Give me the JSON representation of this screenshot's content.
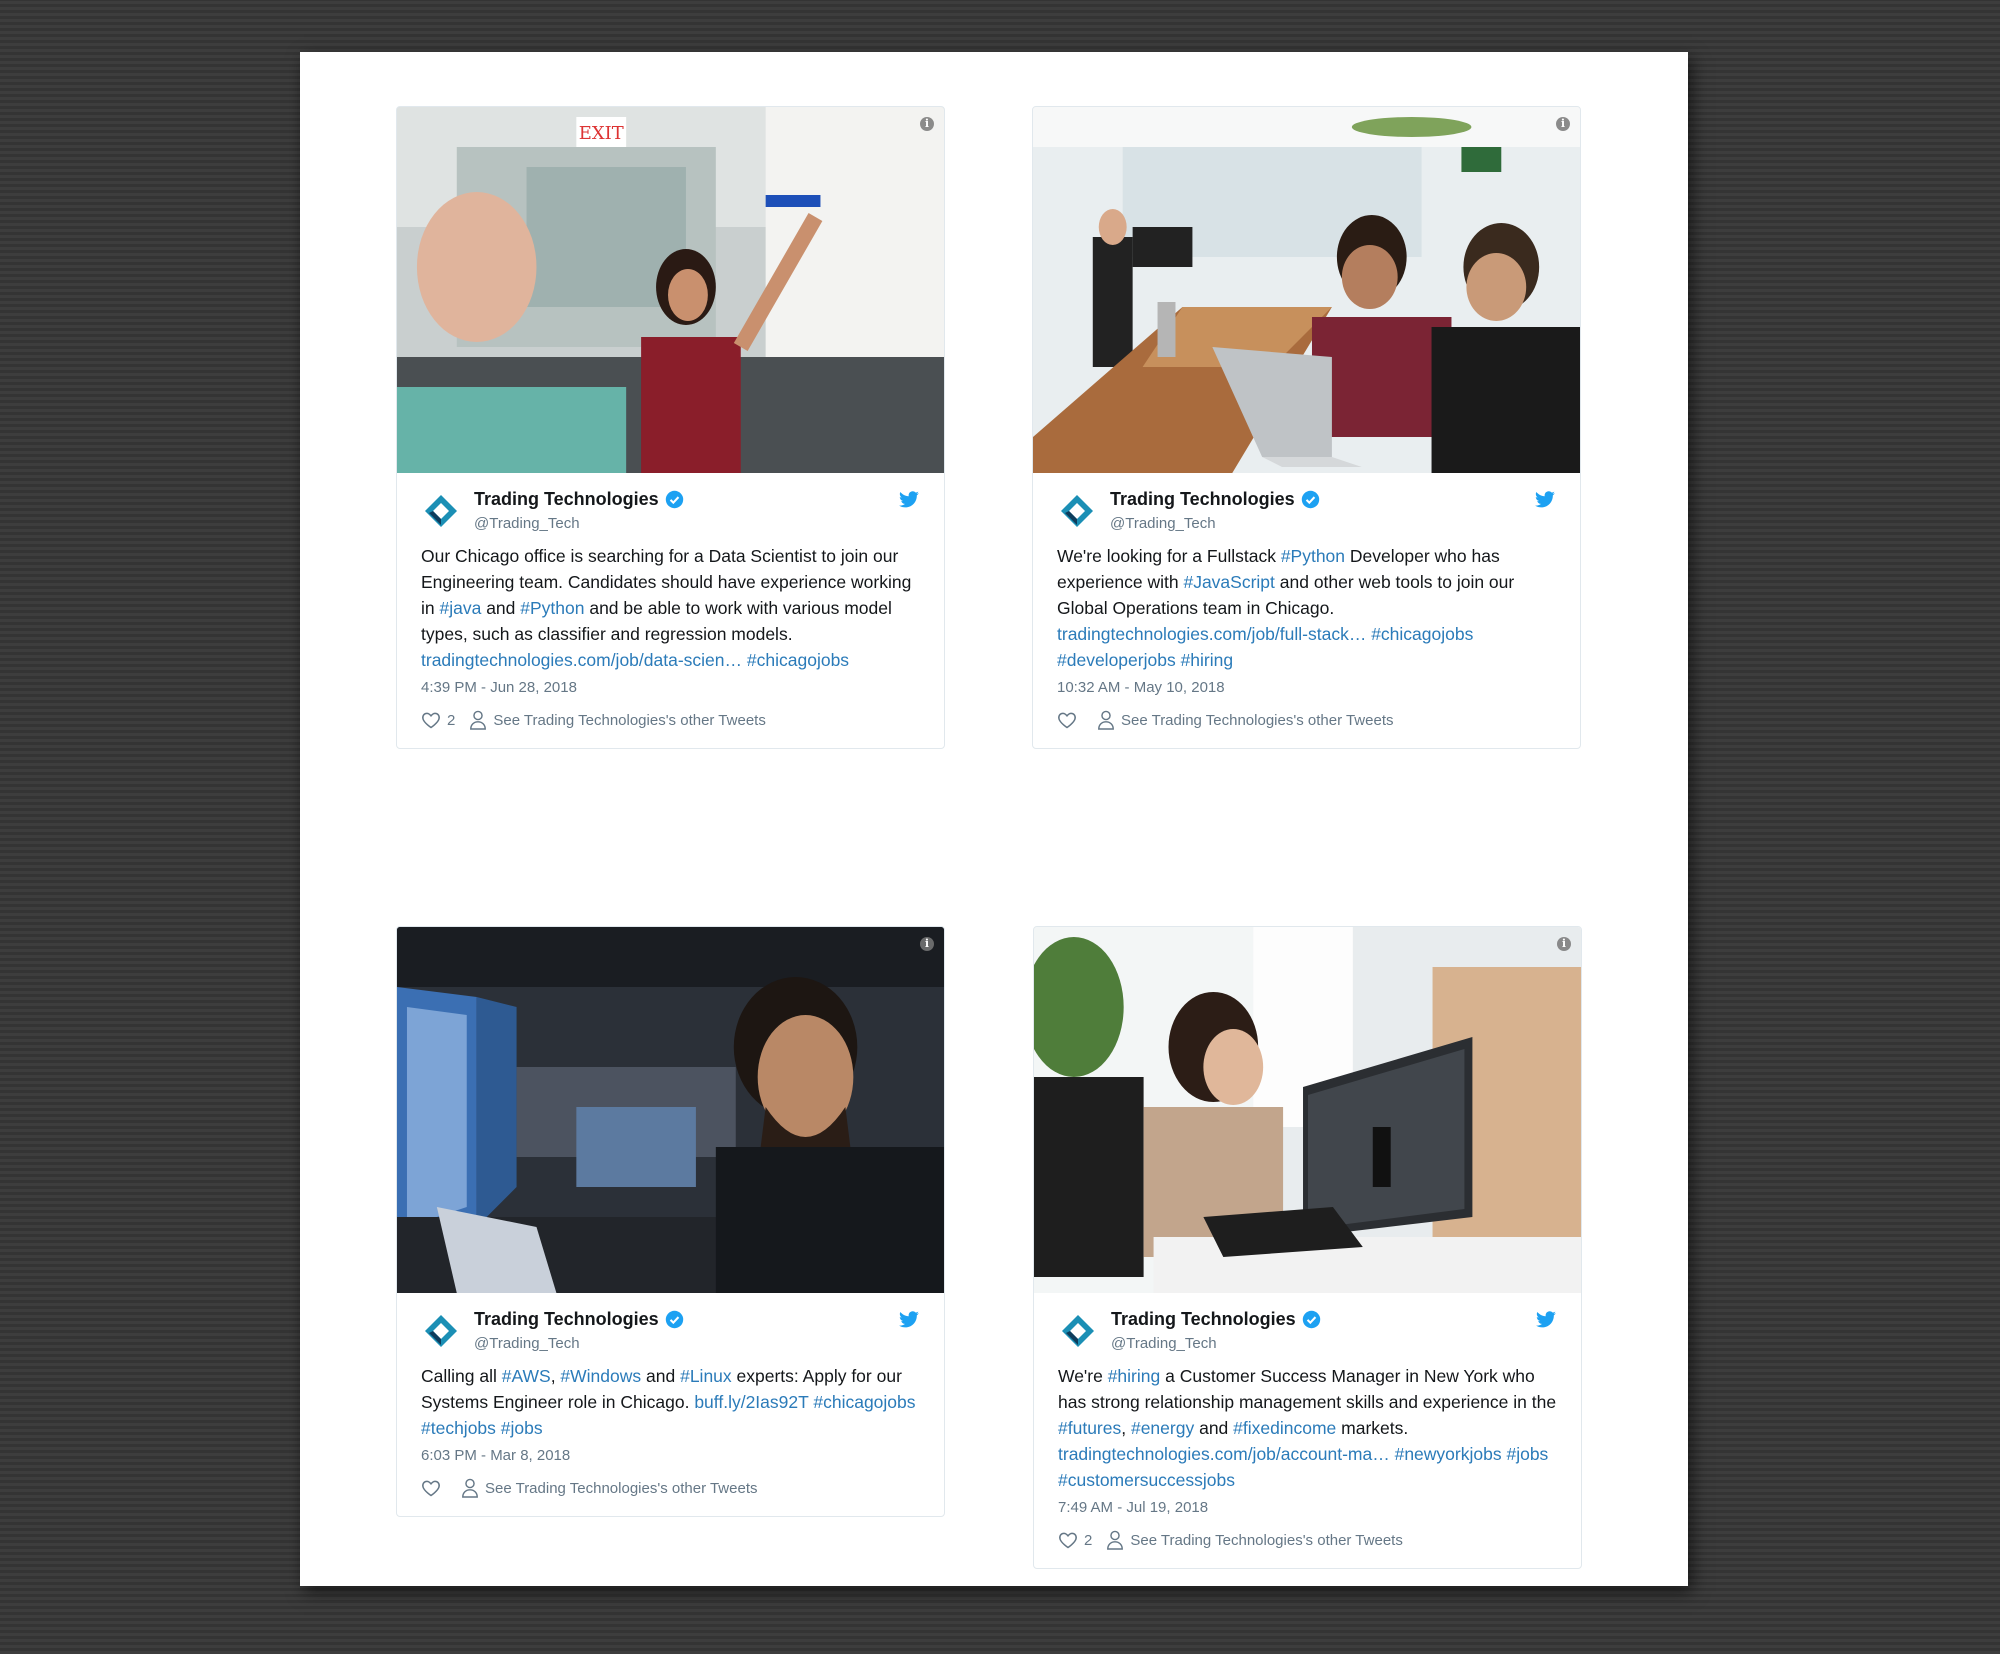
{
  "account": {
    "name": "Trading Technologies",
    "handle": "@Trading_Tech",
    "see_other": "See Trading Technologies's other Tweets"
  },
  "colors": {
    "link": "#2b7bb9",
    "verified": "#1da1f2",
    "bird": "#1da1f2"
  },
  "tweets": [
    {
      "photo_alt": "Office whiteboard discussion",
      "text": [
        {
          "t": "Our Chicago office is searching for a Data Scientist to join our Engineering team. Candidates should have experience working in "
        },
        {
          "t": "#java",
          "link": true
        },
        {
          "t": " and "
        },
        {
          "t": "#Python",
          "link": true
        },
        {
          "t": " and be able to work with various model types, such as classifier and regression models. "
        },
        {
          "t": "tradingtechnologies.com/job/data-scien…",
          "link": true
        },
        {
          "t": " "
        },
        {
          "t": "#chicagojobs",
          "link": true
        }
      ],
      "time": "4:39 PM - Jun 28, 2018",
      "likes": "2"
    },
    {
      "photo_alt": "Two developers at laptop",
      "text": [
        {
          "t": "We're looking for a Fullstack "
        },
        {
          "t": "#Python",
          "link": true
        },
        {
          "t": " Developer who has experience with "
        },
        {
          "t": "#JavaScript",
          "link": true
        },
        {
          "t": " and other web tools to join our Global Operations team in Chicago. "
        },
        {
          "t": "tradingtechnologies.com/job/full-stack…",
          "link": true
        },
        {
          "t": " "
        },
        {
          "t": "#chicagojobs",
          "link": true
        },
        {
          "t": " "
        },
        {
          "t": "#developerjobs",
          "link": true
        },
        {
          "t": " "
        },
        {
          "t": "#hiring",
          "link": true
        }
      ],
      "time": "10:32 AM - May 10, 2018",
      "likes": ""
    },
    {
      "photo_alt": "Engineer at monitors",
      "text": [
        {
          "t": "Calling all "
        },
        {
          "t": "#AWS",
          "link": true
        },
        {
          "t": ", "
        },
        {
          "t": "#Windows",
          "link": true
        },
        {
          "t": " and "
        },
        {
          "t": "#Linux",
          "link": true
        },
        {
          "t": " experts: Apply for our Systems Engineer role in Chicago. "
        },
        {
          "t": "buff.ly/2Ias92T",
          "link": true
        },
        {
          "t": " "
        },
        {
          "t": "#chicagojobs",
          "link": true
        },
        {
          "t": " "
        },
        {
          "t": "#techjobs",
          "link": true
        },
        {
          "t": " "
        },
        {
          "t": "#jobs",
          "link": true
        }
      ],
      "time": "6:03 PM - Mar 8, 2018",
      "likes": ""
    },
    {
      "photo_alt": "Customer success manager at desk",
      "text": [
        {
          "t": "We're "
        },
        {
          "t": "#hiring",
          "link": true
        },
        {
          "t": " a Customer Success Manager in New York who has strong relationship management skills and experience in the "
        },
        {
          "t": "#futures",
          "link": true
        },
        {
          "t": ", "
        },
        {
          "t": "#energy",
          "link": true
        },
        {
          "t": " and "
        },
        {
          "t": "#fixedincome",
          "link": true
        },
        {
          "t": " markets. "
        },
        {
          "t": "tradingtechnologies.com/job/account-ma…",
          "link": true
        },
        {
          "t": " "
        },
        {
          "t": "#newyorkjobs",
          "link": true
        },
        {
          "t": " "
        },
        {
          "t": "#jobs",
          "link": true
        },
        {
          "t": " "
        },
        {
          "t": "#customersuccessjobs",
          "link": true
        }
      ],
      "time": "7:49 AM - Jul 19, 2018",
      "likes": "2"
    }
  ]
}
